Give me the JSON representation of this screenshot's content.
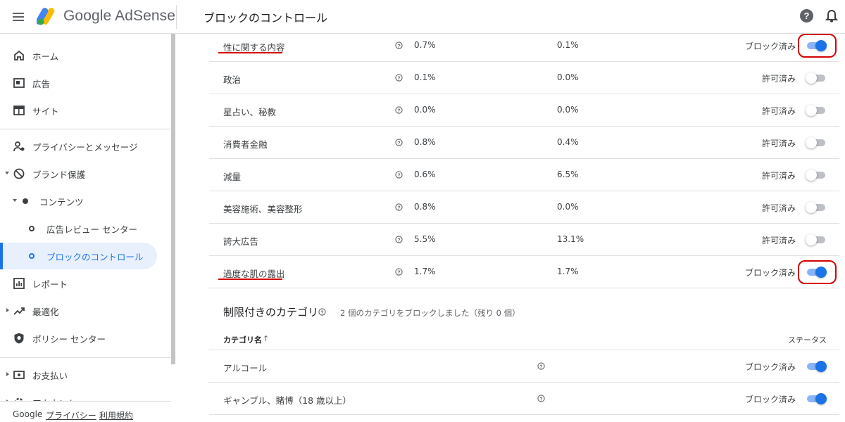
{
  "header": {
    "brand": "Google AdSense",
    "page_title": "ブロックのコントロール",
    "help_label": "?"
  },
  "sidebar": {
    "items": [
      {
        "label": "ホーム",
        "icon": "home-icon"
      },
      {
        "label": "広告",
        "icon": "ad-icon"
      },
      {
        "label": "サイト",
        "icon": "site-icon"
      },
      {
        "label": "プライバシーとメッセージ",
        "icon": "privacy-icon"
      },
      {
        "label": "ブランド保護",
        "icon": "block-icon"
      },
      {
        "label": "コンテンツ",
        "icon": "dot-icon"
      },
      {
        "label": "広告レビュー センター",
        "icon": "ring-icon"
      },
      {
        "label": "ブロックのコントロール",
        "icon": "ring-icon",
        "active": true
      },
      {
        "label": "レポート",
        "icon": "report-icon"
      },
      {
        "label": "最適化",
        "icon": "trend-icon"
      },
      {
        "label": "ポリシー センター",
        "icon": "shield-icon"
      },
      {
        "label": "お支払い",
        "icon": "payment-icon"
      },
      {
        "label": "アカウント",
        "icon": "gear-icon"
      }
    ],
    "footer": {
      "google": "Google",
      "privacy": "プライバシー",
      "terms": "利用規約"
    }
  },
  "sensitive_categories": [
    {
      "name": "性に関する内容",
      "v1": "0.7%",
      "v2": "0.1%",
      "status": "ブロック済み",
      "on": true
    },
    {
      "name": "政治",
      "v1": "0.1%",
      "v2": "0.0%",
      "status": "許可済み",
      "on": false
    },
    {
      "name": "星占い、秘教",
      "v1": "0.0%",
      "v2": "0.0%",
      "status": "許可済み",
      "on": false
    },
    {
      "name": "消費者金融",
      "v1": "0.8%",
      "v2": "0.4%",
      "status": "許可済み",
      "on": false
    },
    {
      "name": "減量",
      "v1": "0.6%",
      "v2": "6.5%",
      "status": "許可済み",
      "on": false
    },
    {
      "name": "美容施術、美容整形",
      "v1": "0.8%",
      "v2": "0.0%",
      "status": "許可済み",
      "on": false
    },
    {
      "name": "誇大広告",
      "v1": "5.5%",
      "v2": "13.1%",
      "status": "許可済み",
      "on": false
    },
    {
      "name": "過度な肌の露出",
      "v1": "1.7%",
      "v2": "1.7%",
      "status": "ブロック済み",
      "on": true
    }
  ],
  "restricted": {
    "title": "制限付きのカテゴリ",
    "subtitle": "2 個のカテゴリをブロックしました（残り 0 個）",
    "col_name": "カテゴリ名",
    "sort_arrow": "↑",
    "col_status": "ステータス",
    "rows": [
      {
        "name": "アルコール",
        "status": "ブロック済み",
        "on": true
      },
      {
        "name": "ギャンブル、賭博（18 歳以上）",
        "status": "ブロック済み",
        "on": true
      }
    ]
  },
  "colors": {
    "accent": "#1a73e8",
    "highlight": "#d50000"
  }
}
